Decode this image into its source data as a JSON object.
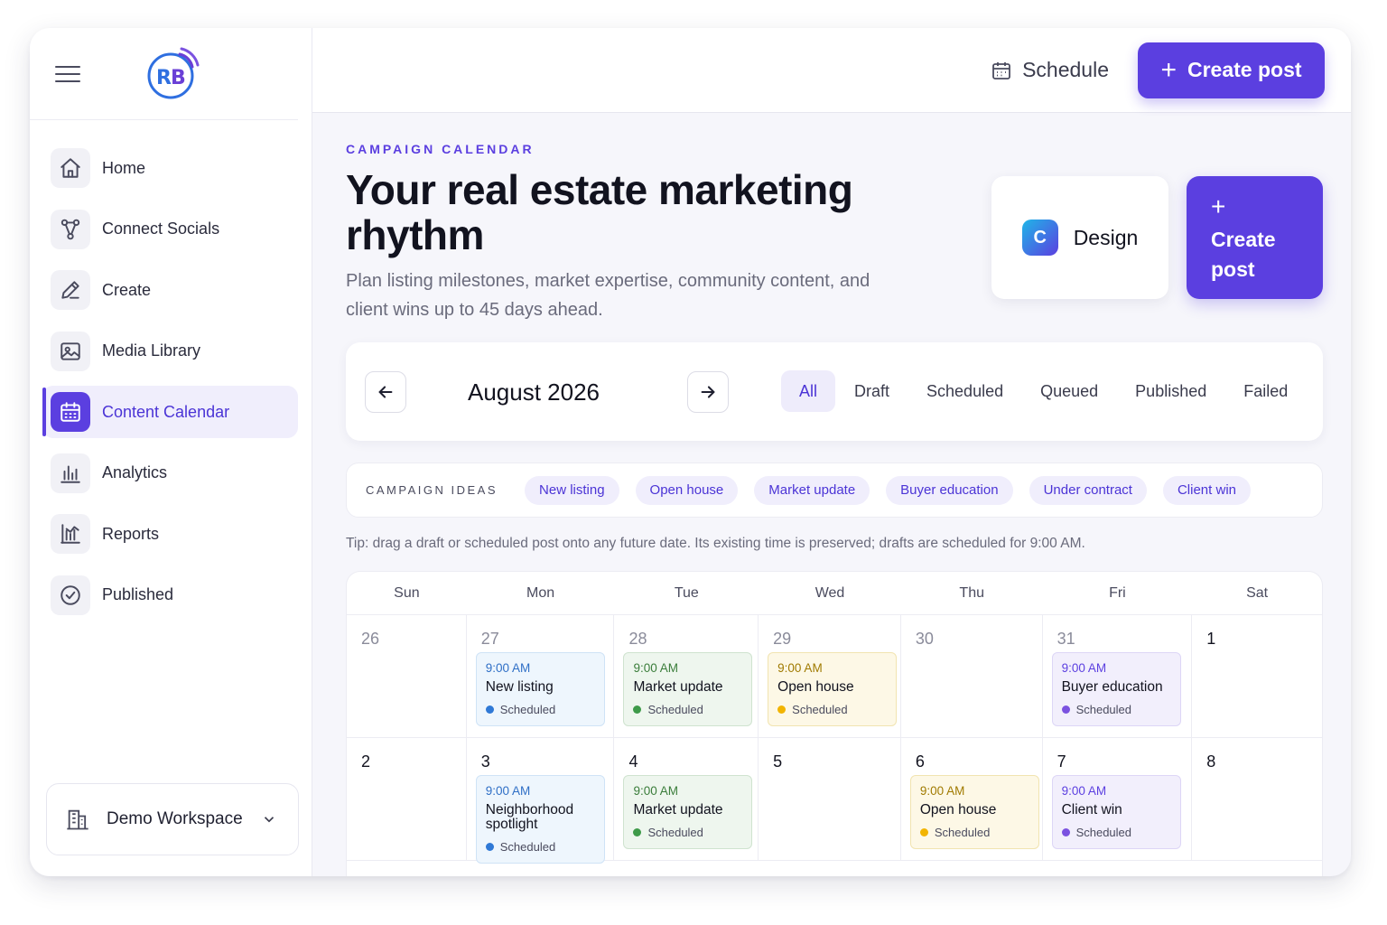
{
  "sidebar": {
    "items": [
      {
        "label": "Home",
        "icon": "home-icon"
      },
      {
        "label": "Connect Socials",
        "icon": "share-nodes-icon"
      },
      {
        "label": "Create",
        "icon": "pencil-icon"
      },
      {
        "label": "Media Library",
        "icon": "image-icon"
      },
      {
        "label": "Content Calendar",
        "icon": "calendar-icon",
        "active": true
      },
      {
        "label": "Analytics",
        "icon": "bar-chart-icon"
      },
      {
        "label": "Reports",
        "icon": "reports-chart-icon"
      },
      {
        "label": "Published",
        "icon": "check-circle-icon"
      }
    ],
    "workspace": "Demo Workspace"
  },
  "topbar": {
    "schedule_label": "Schedule",
    "create_label": "Create post"
  },
  "header": {
    "eyebrow": "CAMPAIGN CALENDAR",
    "title": "Your real estate marketing rhythm",
    "subtitle": "Plan listing milestones, market expertise, community content, and client wins up to 45 days ahead.",
    "design_label": "Design",
    "design_badge": "C",
    "create_plus": "+",
    "create_label": "Create post"
  },
  "month": {
    "label": "August 2026",
    "filters": [
      "All",
      "Draft",
      "Scheduled",
      "Queued",
      "Published",
      "Failed"
    ],
    "active_filter": "All"
  },
  "ideas": {
    "label": "CAMPAIGN IDEAS",
    "chips": [
      "New listing",
      "Open house",
      "Market update",
      "Buyer education",
      "Under contract",
      "Client win"
    ]
  },
  "tip": "Tip: drag a draft or scheduled post onto any future date. Its existing time is preserved; drafts are scheduled for 9:00 AM.",
  "calendar": {
    "weekdays": [
      "Sun",
      "Mon",
      "Tue",
      "Wed",
      "Thu",
      "Fri",
      "Sat"
    ],
    "weeks": [
      [
        {
          "day": "26",
          "muted": true
        },
        {
          "day": "27",
          "muted": true,
          "event": {
            "time": "9:00 AM",
            "title": "New listing",
            "status": "Scheduled",
            "color": "blue"
          }
        },
        {
          "day": "28",
          "muted": true,
          "event": {
            "time": "9:00 AM",
            "title": "Market update",
            "status": "Scheduled",
            "color": "green"
          }
        },
        {
          "day": "29",
          "muted": true,
          "event": {
            "time": "9:00 AM",
            "title": "Open house",
            "status": "Scheduled",
            "color": "yellow"
          }
        },
        {
          "day": "30",
          "muted": true
        },
        {
          "day": "31",
          "muted": true,
          "event": {
            "time": "9:00 AM",
            "title": "Buyer education",
            "status": "Scheduled",
            "color": "purple"
          }
        },
        {
          "day": "1",
          "muted": false
        }
      ],
      [
        {
          "day": "2",
          "muted": false
        },
        {
          "day": "3",
          "muted": false,
          "event": {
            "time": "9:00 AM",
            "title": "Neighborhood spotlight",
            "status": "Scheduled",
            "color": "blue"
          }
        },
        {
          "day": "4",
          "muted": false,
          "event": {
            "time": "9:00 AM",
            "title": "Market update",
            "status": "Scheduled",
            "color": "green"
          }
        },
        {
          "day": "5",
          "muted": false
        },
        {
          "day": "6",
          "muted": false,
          "event": {
            "time": "9:00 AM",
            "title": "Open house",
            "status": "Scheduled",
            "color": "yellow"
          }
        },
        {
          "day": "7",
          "muted": false,
          "event": {
            "time": "9:00 AM",
            "title": "Client win",
            "status": "Scheduled",
            "color": "purple"
          }
        },
        {
          "day": "8",
          "muted": false
        }
      ]
    ]
  },
  "colors": {
    "accent": "#5b3fe0",
    "blue": "#2f79d6",
    "green": "#3e9a49",
    "yellow": "#f2b400",
    "purple": "#7b52e0"
  }
}
